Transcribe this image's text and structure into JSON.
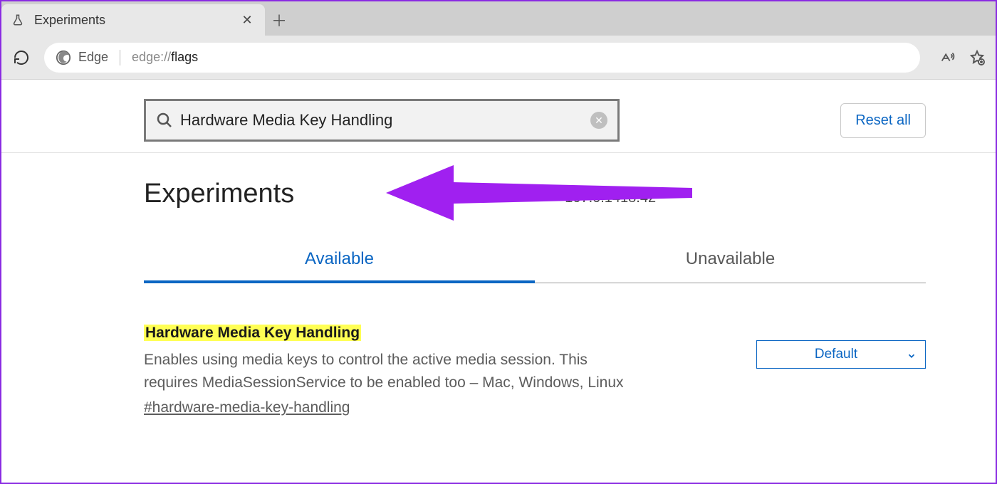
{
  "browser": {
    "tab_title": "Experiments",
    "address_label": "Edge",
    "url_prefix": "edge://",
    "url_page": "flags"
  },
  "search": {
    "value": "Hardware Media Key Handling"
  },
  "buttons": {
    "reset_all": "Reset all"
  },
  "header": {
    "title": "Experiments",
    "version": "107.0.1418.42"
  },
  "tabs": {
    "available": "Available",
    "unavailable": "Unavailable"
  },
  "flag": {
    "title": "Hardware Media Key Handling",
    "description": "Enables using media keys to control the active media session. This requires MediaSessionService to be enabled too – Mac, Windows, Linux",
    "anchor": "#hardware-media-key-handling",
    "select_value": "Default"
  }
}
